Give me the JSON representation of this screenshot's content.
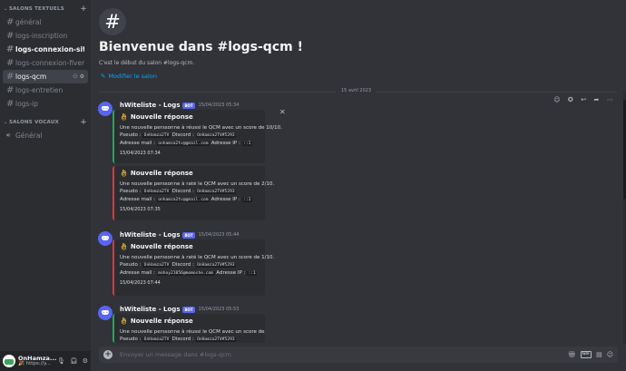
{
  "sidebar": {
    "text_category": "SALONS TEXTUELS",
    "voice_category": "SALONS VOCAUX",
    "text_channels": [
      {
        "name": "général"
      },
      {
        "name": "logs-inscription"
      },
      {
        "name": "logs-connexion-site"
      },
      {
        "name": "logs-connexion-fivem"
      },
      {
        "name": "logs-qcm"
      },
      {
        "name": "logs-entretien"
      },
      {
        "name": "logs-ip"
      }
    ],
    "voice_channels": [
      {
        "name": "Général"
      }
    ]
  },
  "user": {
    "name": "OnHamza...",
    "status": "🎉 https://y..."
  },
  "channel": {
    "hero_icon": "#",
    "welcome": "Bienvenue dans #logs-qcm !",
    "subtitle": "C'est le début du salon #logs-qcm.",
    "edit_link": "Modifier le salon",
    "date_divider": "15 avril 2023"
  },
  "messages": [
    {
      "author": "hWiteliste - Logs",
      "badge": "BOT",
      "time": "15/04/2023 05:34",
      "embeds": [
        {
          "color": "#23a55a",
          "title": "Nouvelle réponse",
          "line1": "Une nouvelle perssonne à réussi le QCM avec un score de 10/10.",
          "pseudo_label": "Pseudo :",
          "pseudo": "OnHamza2TV",
          "discord_label": "Discord :",
          "discord": "OnHamza2TV#5293",
          "mail_label": "Adresse mail :",
          "mail": "onhamza2tv@gmail.com",
          "ip_label": "Adresse IP :",
          "ip": "::1",
          "footer": "15/04/2023 07:34"
        },
        {
          "color": "#da373c",
          "title": "Nouvelle réponse",
          "line1": "Une nouvelle perssonne à raté le QCM avec un score de 2/10.",
          "pseudo_label": "Pseudo :",
          "pseudo": "OnHamza2TV",
          "discord_label": "Discord :",
          "discord": "OnHamza2TV#5293",
          "mail_label": "Adresse mail :",
          "mail": "onhamza2tv@gmail.com",
          "ip_label": "Adresse IP :",
          "ip": "::1",
          "footer": "15/04/2023 07:35"
        }
      ]
    },
    {
      "author": "hWiteliste - Logs",
      "badge": "BOT",
      "time": "15/04/2023 05:44",
      "embeds": [
        {
          "color": "#da373c",
          "title": "Nouvelle réponse",
          "line1": "Une nouvelle perssonne à raté le QCM avec un score de 1/10.",
          "pseudo_label": "Pseudo :",
          "pseudo": "OnHamza2TV",
          "discord_label": "Discord :",
          "discord": "OnHamza2TV#5293",
          "mail_label": "Adresse mail :",
          "mail": "mohoy21056@momoshe.com",
          "ip_label": "Adresse IP :",
          "ip": "::1",
          "footer": "15/04/2023 07:44"
        }
      ]
    },
    {
      "author": "hWiteliste - Logs",
      "badge": "BOT",
      "time": "15/04/2023 05:53",
      "embeds": [
        {
          "color": "#23a55a",
          "title": "Nouvelle réponse",
          "line1": "Une nouvelle perssonne à réussi le QCM avec un score de 5/10.",
          "pseudo_label": "Pseudo :",
          "pseudo": "OnHamza2TV",
          "discord_label": "Discord :",
          "discord": "OnHamza2TV#5293"
        }
      ]
    }
  ],
  "composer": {
    "placeholder": "Envoyer un message dans #logs-qcm",
    "gif_label": "GIF"
  }
}
